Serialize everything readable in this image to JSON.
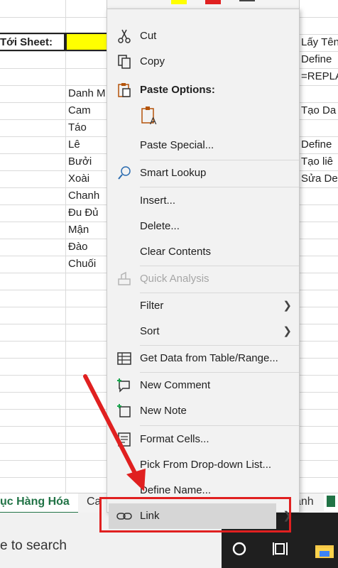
{
  "sheet": {
    "label_to_sheet": "Tới Sheet:",
    "fruits": [
      "Danh M",
      "Cam",
      "Táo",
      "Lê",
      "Bưởi",
      "Xoài",
      "Chanh",
      "Đu Đủ",
      "Mận",
      "Đào",
      "Chuối"
    ],
    "right_col": {
      "r1": "Lấy Tên",
      "r2": "Define",
      "r3": "=REPLA",
      "r4": "Tạo Da",
      "r5": "Define",
      "r6": "Tạo liê",
      "r7": "Sửa De"
    },
    "highlight_color": "#ffff00"
  },
  "tabs": {
    "active": "ục Hàng Hóa",
    "next": "Ca",
    "right": "anh"
  },
  "taskbar": {
    "search_text": "e to search"
  },
  "menu": {
    "cut": "Cut",
    "copy": "Copy",
    "paste_options": "Paste Options:",
    "paste_special": "Paste Special...",
    "smart_lookup": "Smart Lookup",
    "insert": "Insert...",
    "delete": "Delete...",
    "clear_contents": "Clear Contents",
    "quick_analysis": "Quick Analysis",
    "filter": "Filter",
    "sort": "Sort",
    "get_data": "Get Data from Table/Range...",
    "new_comment": "New Comment",
    "new_note": "New Note",
    "format_cells": "Format Cells...",
    "pick_dropdown": "Pick From Drop-down List...",
    "define_name": "Define Name...",
    "link": "Link"
  },
  "colors": {
    "annotation_red": "#e02020",
    "excel_green": "#217346"
  }
}
